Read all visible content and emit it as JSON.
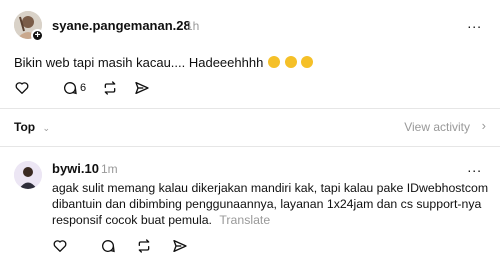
{
  "post": {
    "username": "syane.pangemanan.28",
    "time": "1h",
    "more_label": "...",
    "text": "Bikin web tapi masih kacau.... Hadeeehhhh",
    "emojis": [
      "sad-face",
      "weary-face",
      "smirk-face"
    ],
    "reply_count": "6"
  },
  "sort": {
    "label": "Top",
    "view_activity": "View activity"
  },
  "reply": {
    "username": "bywi.10",
    "time": "1m",
    "text": "agak sulit memang kalau dikerjakan mandiri kak, tapi kalau pake IDwebhostcom dibantuin dan dibimbing penggunaannya, layanan 1x24jam dan cs support-nya responsif cocok buat pemula.",
    "translate": "Translate"
  },
  "colors": {
    "text": "#101010",
    "muted": "#999999",
    "divider": "#e6e6e6",
    "emoji": "#f5c028"
  },
  "icons": [
    "heart-icon",
    "comment-icon",
    "repost-icon",
    "share-icon",
    "chevron-down-icon",
    "chevron-right-icon",
    "plus-icon"
  ]
}
